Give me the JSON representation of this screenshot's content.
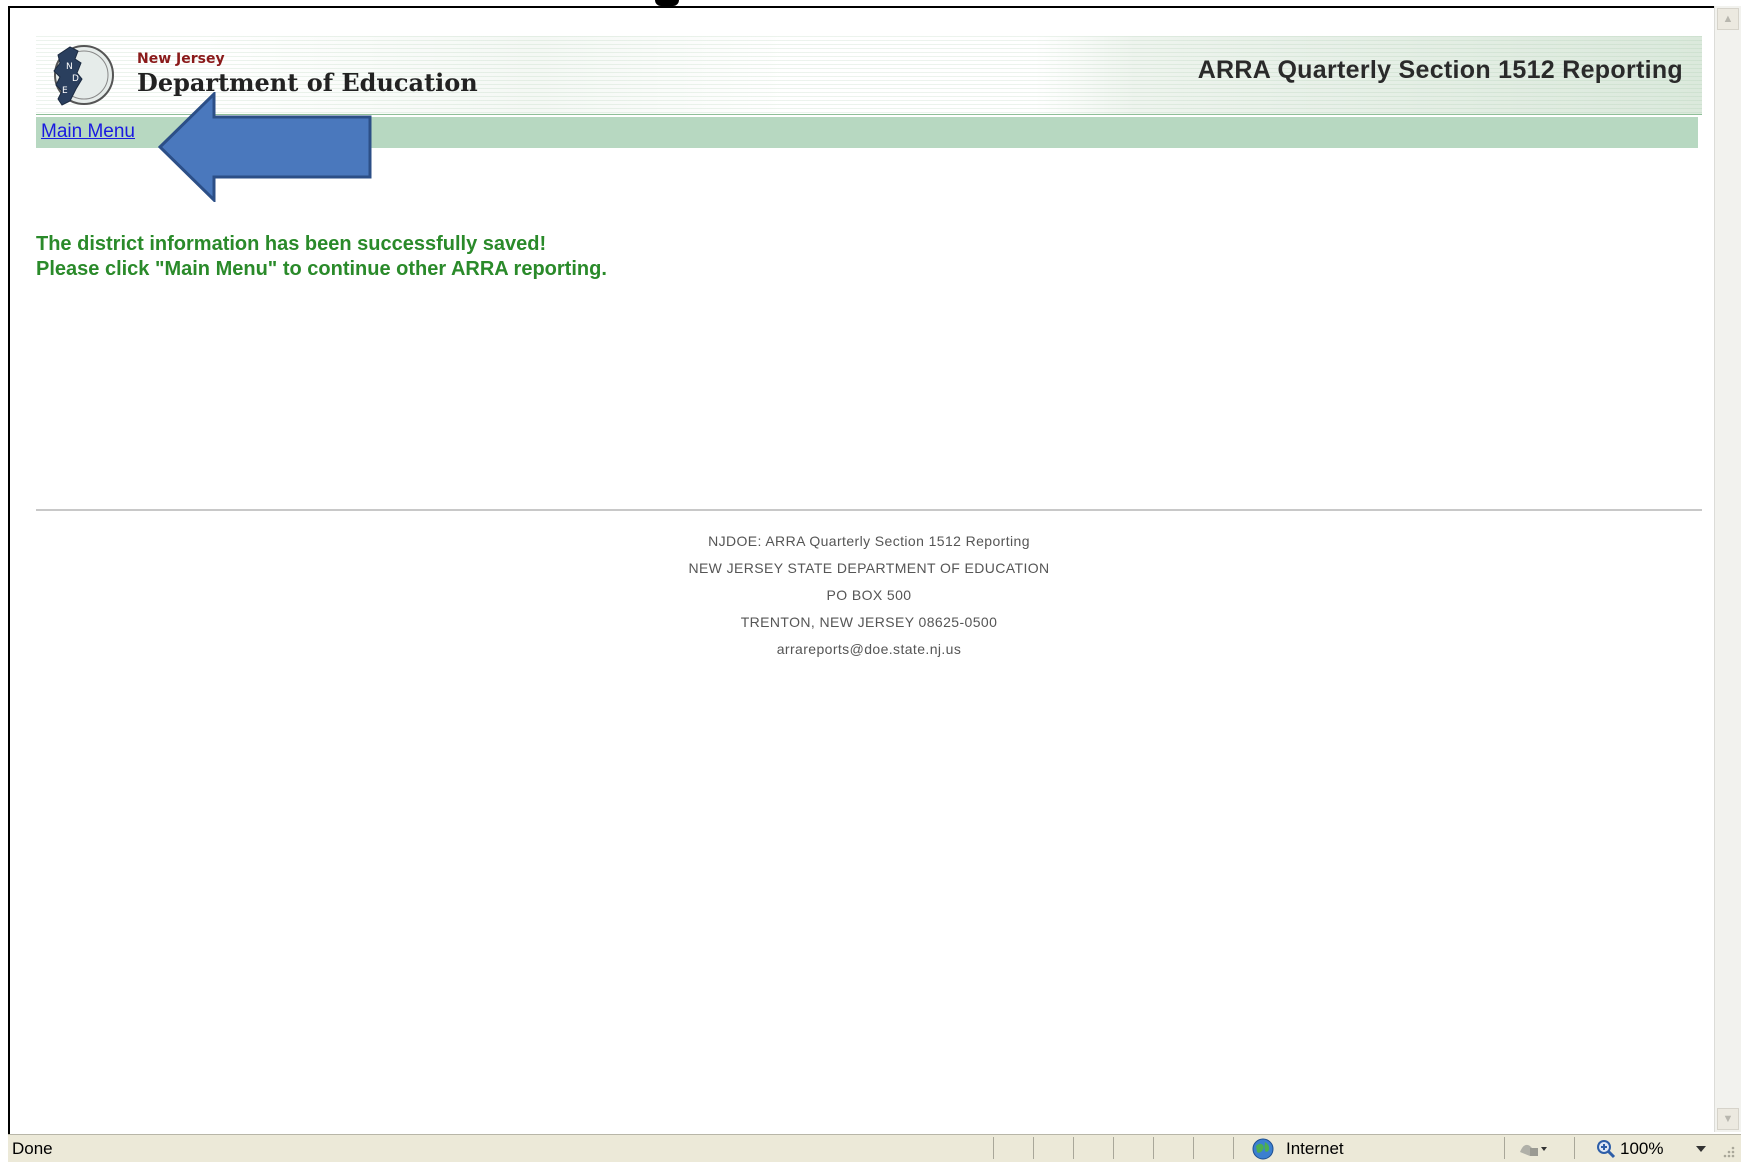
{
  "header": {
    "org_small": "New Jersey",
    "org_name": "Department of Education",
    "app_title": "ARRA Quarterly Section 1512 Reporting"
  },
  "nav": {
    "main_menu_label": "Main Menu"
  },
  "message": {
    "line1": "The district information has been successfully saved!",
    "line2": "Please click \"Main Menu\" to continue other ARRA reporting."
  },
  "footer": {
    "line1": "NJDOE: ARRA Quarterly Section 1512 Reporting",
    "line2": "NEW JERSEY STATE DEPARTMENT OF EDUCATION",
    "line3": "PO BOX 500",
    "line4": "TRENTON, NEW JERSEY 08625-0500",
    "line5": "arrareports@doe.state.nj.us"
  },
  "statusbar": {
    "status": "Done",
    "zone": "Internet",
    "zoom": "100%"
  },
  "colors": {
    "nav_bar": "#b7d8c1",
    "link": "#1a1ae0",
    "success_text": "#2a8a2a",
    "callout_arrow": "#4a78bd"
  },
  "icons": {
    "logo": "njdoe-seal-icon",
    "zone": "internet-globe-icon",
    "protected_mode": "protected-mode-icon",
    "zoom": "zoom-magnifier-icon"
  }
}
